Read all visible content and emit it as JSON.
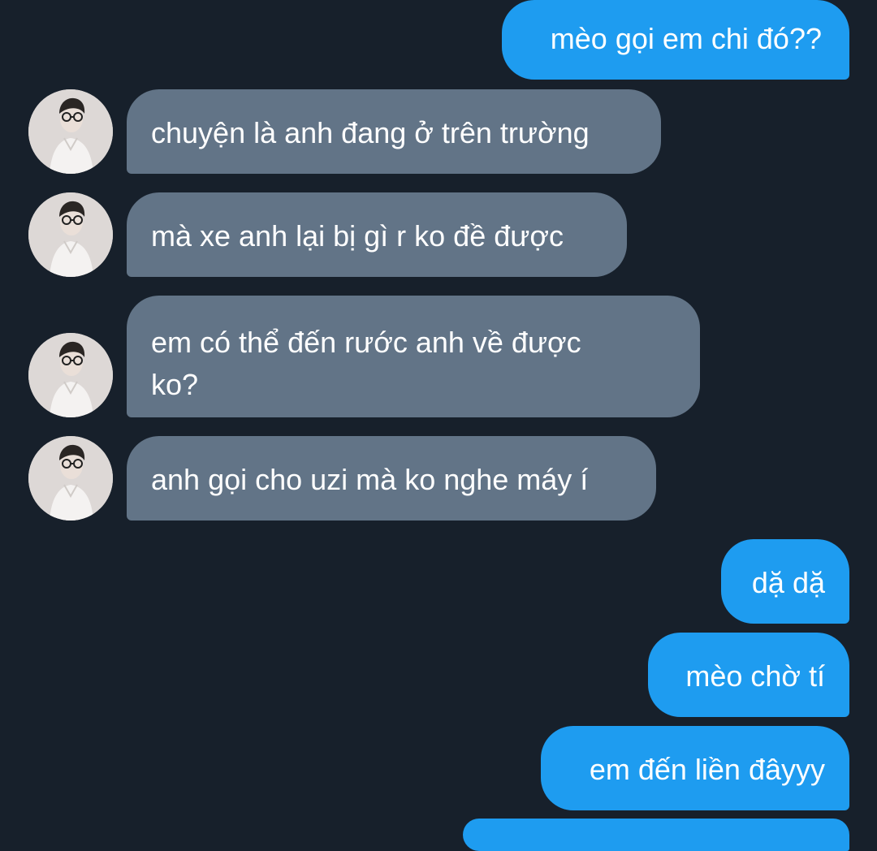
{
  "conversation": {
    "messages": [
      {
        "sender": "me",
        "text": "mèo gọi em chi đó??"
      },
      {
        "sender": "contact",
        "text": "chuyện là anh đang ở trên trường"
      },
      {
        "sender": "contact",
        "text": "mà xe anh lại bị gì r ko đề được"
      },
      {
        "sender": "contact",
        "text": "em có thể đến rước anh về được ko?"
      },
      {
        "sender": "contact",
        "text": "anh gọi cho uzi mà ko nghe máy í"
      },
      {
        "sender": "me",
        "text": "dặ dặ"
      },
      {
        "sender": "me",
        "text": "mèo chờ tí"
      },
      {
        "sender": "me",
        "text": "em đến liền đâyyy"
      }
    ]
  },
  "contact": {
    "avatar_icon": "profile-photo-icon"
  },
  "colors": {
    "background": "#17202b",
    "outgoing_bubble": "#1e9cf0",
    "incoming_bubble": "#627487",
    "text": "#ffffff"
  }
}
